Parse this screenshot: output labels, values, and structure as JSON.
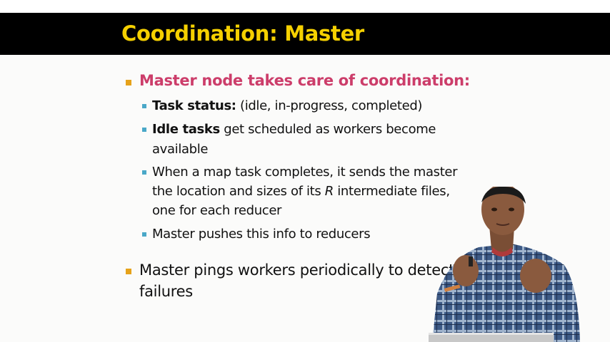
{
  "slide": {
    "title": "Coordination: Master",
    "bullets": [
      {
        "text": "Master node takes care of coordination:",
        "sub": [
          {
            "bold": "Task status:",
            "text": " (idle, in-progress, completed)"
          },
          {
            "bold": "Idle tasks",
            "text_line1": " get scheduled as workers become",
            "text_line2": "available"
          },
          {
            "text_line1": "When a map task completes, it sends the master",
            "text_line2_a": "the location and sizes of its ",
            "text_line2_italic": "R",
            "text_line2_b": " intermediate files,",
            "text_line3": "one for each reducer"
          },
          {
            "text": "Master pushes this info to reducers"
          }
        ]
      },
      {
        "text_line1": "Master pings workers periodically to detect",
        "text_line2": "failures"
      }
    ]
  },
  "colors": {
    "title_bar": "#000000",
    "title_text": "#f5d000",
    "accent_text": "#cc3d6a",
    "bullet_square": "#e6a21a",
    "sub_bullet_square": "#4aa8c8"
  }
}
